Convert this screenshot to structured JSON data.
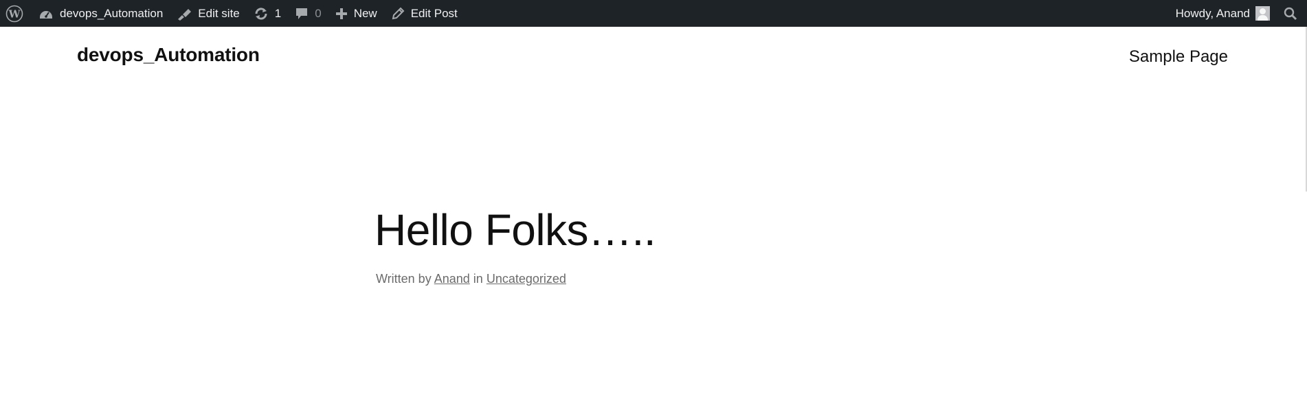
{
  "admin_bar": {
    "site_name": "devops_Automation",
    "edit_site_label": "Edit site",
    "updates_count": "1",
    "comments_count": "0",
    "new_label": "New",
    "edit_post_label": "Edit Post",
    "greeting": "Howdy, Anand",
    "icons": [
      "wordpress-icon",
      "dashboard-icon",
      "brush-icon",
      "updates-icon",
      "comment-icon",
      "plus-icon",
      "pencil-icon",
      "avatar",
      "search-icon"
    ],
    "background_color": "#1d2327"
  },
  "site": {
    "title": "devops_Automation",
    "nav": [
      {
        "label": "Sample Page"
      }
    ]
  },
  "post": {
    "title": "Hello Folks…..",
    "written_by_label": "Written by",
    "author": "Anand",
    "in_label": "in",
    "category": "Uncategorized"
  }
}
